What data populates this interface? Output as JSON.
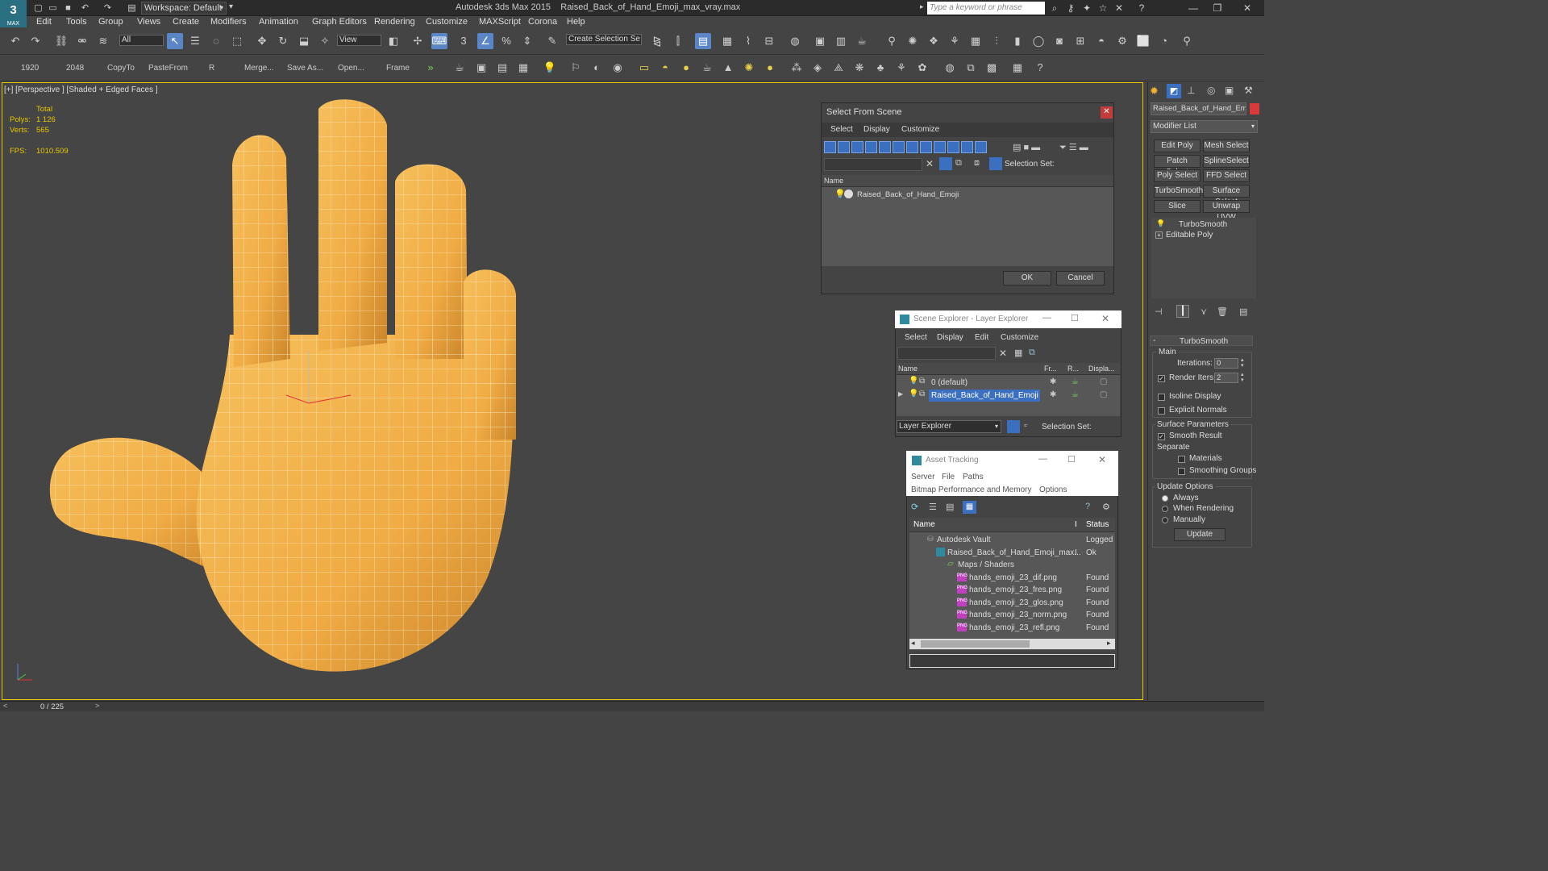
{
  "title_bar": {
    "app_logo": "MAX",
    "workspace": "Workspace: Default",
    "app_name": "Autodesk 3ds Max  2015",
    "file_name": "Raised_Back_of_Hand_Emoji_max_vray.max",
    "search_placeholder": "Type a keyword or phrase"
  },
  "menu": [
    "Edit",
    "Tools",
    "Group",
    "Views",
    "Create",
    "Modifiers",
    "Animation",
    "Graph Editors",
    "Rendering",
    "Customize",
    "MAXScript",
    "Corona",
    "Help"
  ],
  "toolbar1": {
    "filter": "All",
    "ref_coord": "View",
    "selection_set": "Create Selection Se"
  },
  "toolbar2": {
    "items": [
      "1920",
      "2048",
      "CopyTo",
      "PasteFrom",
      "R",
      "Merge...",
      "Save As...",
      "Open...",
      "Frame"
    ]
  },
  "viewport": {
    "label": "[+] [Perspective ] [Shaded + Edged Faces ]",
    "stats_header": "Total",
    "polys_label": "Polys:",
    "polys_value": "1 126",
    "verts_label": "Verts:",
    "verts_value": "565",
    "fps_label": "FPS:",
    "fps_value": "1010.509"
  },
  "timeline": {
    "frame": "0 / 225"
  },
  "select_from_scene": {
    "title": "Select From Scene",
    "menu": [
      "Select",
      "Display",
      "Customize"
    ],
    "selection_set_label": "Selection Set:",
    "column_name": "Name",
    "item": "Raised_Back_of_Hand_Emoji",
    "ok": "OK",
    "cancel": "Cancel"
  },
  "scene_explorer": {
    "title": "Scene Explorer - Layer Explorer",
    "menu": [
      "Select",
      "Display",
      "Edit",
      "Customize"
    ],
    "columns": [
      "Name",
      "Fr...",
      "R...",
      "Displa..."
    ],
    "rows": [
      "0 (default)",
      "Raised_Back_of_Hand_Emoji"
    ],
    "footer_combo": "Layer Explorer",
    "selection_set_label": "Selection Set:"
  },
  "asset_tracking": {
    "title": "Asset Tracking",
    "menu1": [
      "Server",
      "File",
      "Paths"
    ],
    "menu2": [
      "Bitmap Performance and Memory",
      "Options"
    ],
    "columns": [
      "Name",
      "I",
      "Status"
    ],
    "rows": [
      {
        "name": "Autodesk Vault",
        "status": "Logged"
      },
      {
        "name": "Raised_Back_of_Hand_Emoji_max...",
        "status": "Ok",
        "flag": "I"
      },
      {
        "name": "Maps / Shaders",
        "status": ""
      },
      {
        "name": "hands_emoji_23_dif.png",
        "status": "Found"
      },
      {
        "name": "hands_emoji_23_fres.png",
        "status": "Found"
      },
      {
        "name": "hands_emoji_23_glos.png",
        "status": "Found"
      },
      {
        "name": "hands_emoji_23_norm.png",
        "status": "Found"
      },
      {
        "name": "hands_emoji_23_refl.png",
        "status": "Found"
      }
    ]
  },
  "command_panel": {
    "object_name": "Raised_Back_of_Hand_Emoji",
    "object_color": "#d63a3a",
    "modifier_list": "Modifier List",
    "buttons": [
      "Edit Poly",
      "Mesh Select",
      "Patch Select",
      "SplineSelect",
      "Poly Select",
      "FFD Select",
      "TurboSmooth",
      "Surface Select",
      "Slice",
      "Unwrap UVW"
    ],
    "stack": [
      "TurboSmooth",
      "Editable Poly"
    ],
    "rollout_title": "TurboSmooth",
    "main_label": "Main",
    "iterations_label": "Iterations:",
    "iterations_value": "0",
    "render_iters_label": "Render Iters:",
    "render_iters_value": "2",
    "isoline_label": "Isoline Display",
    "explicit_normals_label": "Explicit Normals",
    "surface_params_label": "Surface Parameters",
    "smooth_result_label": "Smooth Result",
    "separate_label": "Separate",
    "materials_label": "Materials",
    "smoothing_groups_label": "Smoothing Groups",
    "update_options_label": "Update Options",
    "always_label": "Always",
    "when_rendering_label": "When Rendering",
    "manually_label": "Manually",
    "update_button": "Update"
  },
  "colors": {
    "accent": "#5a86c8",
    "viewport_border": "#e8c600",
    "hand": "#f2b24c"
  }
}
